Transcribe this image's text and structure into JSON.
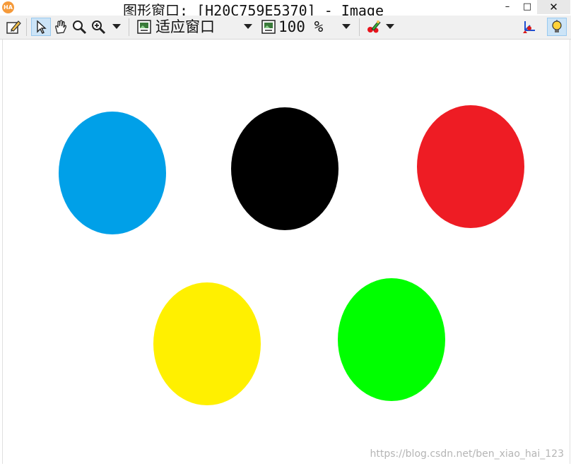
{
  "window": {
    "app_icon_label": "HA",
    "title": "图形窗口: [H20C759E5370] - Image",
    "minimize_glyph": "–",
    "maximize_glyph": "□",
    "close_glyph": "✕"
  },
  "toolbar": {
    "icons": [
      "edit-icon",
      "pointer-icon",
      "pan-hand-icon",
      "magnifier-icon",
      "zoom-in-icon",
      "fit-window-icon",
      "zoom-percent-icon",
      "color-tool-icon",
      "axes-icon",
      "lightbulb-icon"
    ],
    "fit_mode_label": "适应窗口",
    "zoom_label": "100 %"
  },
  "canvas": {
    "background": "#ffffff",
    "blobs": [
      {
        "name": "blue-blob",
        "color": "#00a0e8"
      },
      {
        "name": "black-blob",
        "color": "#000000"
      },
      {
        "name": "red-blob",
        "color": "#ee1c24"
      },
      {
        "name": "yellow-blob",
        "color": "#fff000"
      },
      {
        "name": "green-blob",
        "color": "#00ff00"
      }
    ]
  },
  "watermark": "https://blog.csdn.net/ben_xiao_hai_123"
}
